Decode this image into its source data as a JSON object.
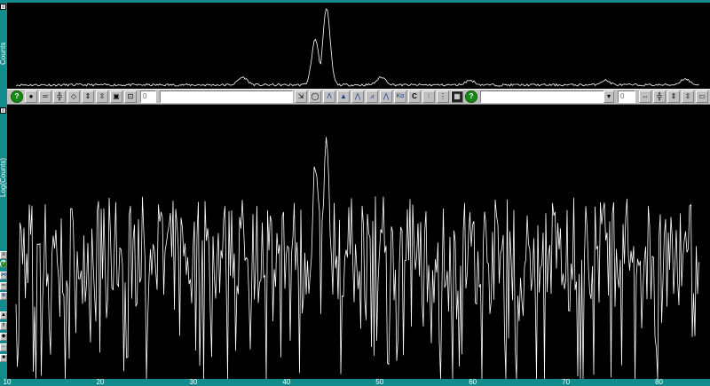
{
  "panels": {
    "top": {
      "y_label": "Counts"
    },
    "main": {
      "y_label": "Log(Counts)"
    }
  },
  "x_axis": {
    "min": 10,
    "max": 85,
    "ticks": [
      "10",
      "20",
      "30",
      "40",
      "50",
      "60",
      "70",
      "80"
    ]
  },
  "toolbar": {
    "left_buttons": [
      "help-icon",
      "record-icon",
      "minus-icon",
      "zoom-x-icon",
      "expand-icon",
      "compress-y-icon",
      "expand-y-icon",
      "fit-icon",
      "restore-icon"
    ],
    "left_value": "0",
    "middle_buttons": [
      "peak-search-icon",
      "magnify-icon",
      "peak-icon",
      "fill-peak-icon",
      "profile-fit-icon",
      "peak-table-icon",
      "peak-label-icon",
      "k-alpha-icon",
      "calibrate-icon",
      "cursor-icon",
      "pattern-icon",
      "grid-icon",
      "help-icon"
    ],
    "calibrate_label": "C",
    "k_alpha_label": "Kα",
    "right_value": "0"
  },
  "colors": {
    "background": "#000000",
    "axis_bar": "#118b8b",
    "trace": "#ffffff",
    "toolbar": "#c0c0c0",
    "help_button": "#138a13"
  },
  "chart_data": {
    "type": "line",
    "description_of_series": "XRD scan counts vs 2-theta",
    "x_range": [
      10,
      85
    ],
    "peaks_2theta": [
      35.3,
      43.1,
      44.3,
      50.2,
      59.7,
      74.2,
      82.8
    ],
    "peak_relative_heights_log": [
      0.6,
      0.88,
      1.0,
      0.6,
      0.6,
      0.55,
      0.6
    ],
    "peak_relative_heights_linear": [
      0.1,
      0.6,
      1.0,
      0.1,
      0.06,
      0.06,
      0.08
    ],
    "grid": false
  }
}
